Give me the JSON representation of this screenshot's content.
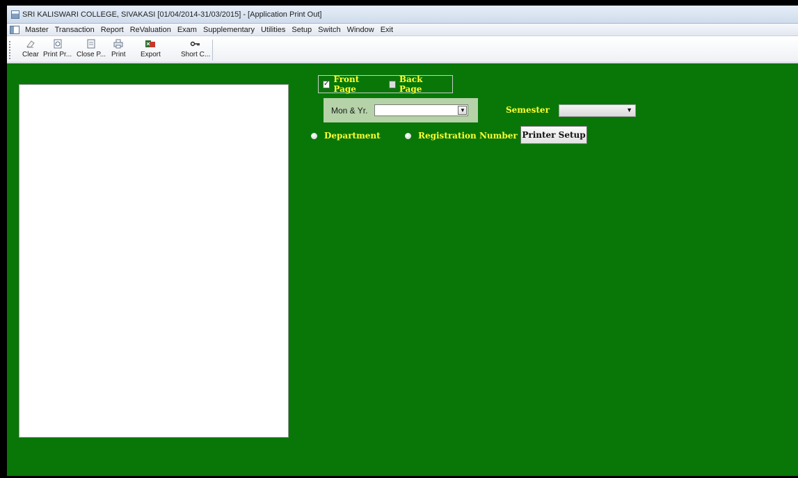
{
  "window": {
    "title": "SRI KALISWARI COLLEGE, SIVAKASI [01/04/2014-31/03/2015] - [Application Print Out]"
  },
  "menu": {
    "items": [
      {
        "label": "Master"
      },
      {
        "label": "Transaction"
      },
      {
        "label": "Report"
      },
      {
        "label": "ReValuation"
      },
      {
        "label": "Exam"
      },
      {
        "label": "Supplementary"
      },
      {
        "label": "Utilities"
      },
      {
        "label": "Setup"
      },
      {
        "label": "Switch"
      },
      {
        "label": "Window"
      },
      {
        "label": "Exit"
      }
    ]
  },
  "toolbar": {
    "buttons": [
      {
        "label": "Clear",
        "icon": "eraser-icon"
      },
      {
        "label": "Print Pr...",
        "icon": "print-preview-icon"
      },
      {
        "label": "Close P...",
        "icon": "close-preview-icon"
      },
      {
        "label": "Print",
        "icon": "printer-icon"
      },
      {
        "label": "Export",
        "icon": "export-icon"
      },
      {
        "label": "Short C...",
        "icon": "key-icon"
      }
    ]
  },
  "form": {
    "front_page": {
      "label": "Front Page",
      "checked": true
    },
    "back_page": {
      "label": "Back Page",
      "checked": false
    },
    "mon_yr": {
      "label": "Mon & Yr.",
      "value": ""
    },
    "semester": {
      "label": "Semester",
      "value": ""
    },
    "radio_department": {
      "label": "Department"
    },
    "radio_regno": {
      "label": "Registration Number"
    },
    "printer_setup_label": "Printer Setup"
  },
  "colors": {
    "background": "#087708",
    "label_text": "#ffff33",
    "monyr_panel": "#b5d2a8"
  }
}
